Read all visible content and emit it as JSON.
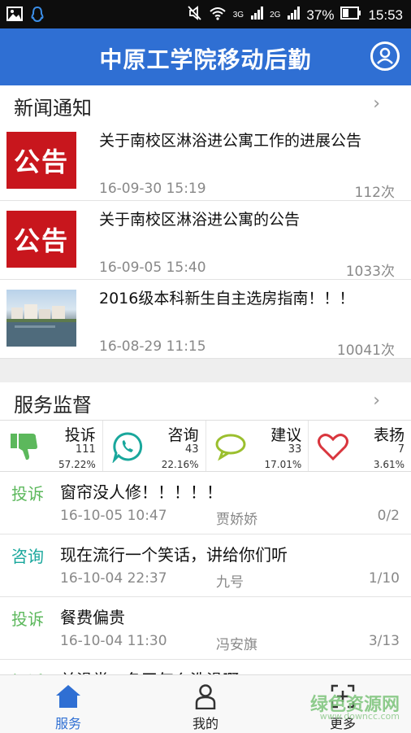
{
  "status_bar": {
    "network_3g": "3G",
    "network_2g": "2G",
    "battery": "37%",
    "time": "15:53"
  },
  "header": {
    "title": "中原工学院移动后勤"
  },
  "news": {
    "section_title": "新闻通知",
    "items": [
      {
        "thumb_text": "公告",
        "title": "关于南校区淋浴进公寓工作的进展公告",
        "date": "16-09-30 15:19",
        "count": "112次"
      },
      {
        "thumb_text": "公告",
        "title": "关于南校区淋浴进公寓的公告",
        "date": "16-09-05 15:40",
        "count": "1033次"
      },
      {
        "thumb_text": "",
        "title": "2016级本科新生自主选房指南！！！",
        "date": "16-08-29 11:15",
        "count": "10041次"
      }
    ]
  },
  "service": {
    "section_title": "服务监督",
    "stats": [
      {
        "name": "投诉",
        "count": "111",
        "percent": "57.22%",
        "icon": "thumbs-down-icon",
        "color": "#5cb85c"
      },
      {
        "name": "咨询",
        "count": "43",
        "percent": "22.16%",
        "icon": "chat-phone-icon",
        "color": "#19a79c"
      },
      {
        "name": "建议",
        "count": "33",
        "percent": "17.01%",
        "icon": "speech-bubble-icon",
        "color": "#9bbf2e"
      },
      {
        "name": "表扬",
        "count": "7",
        "percent": "3.61%",
        "icon": "heart-icon",
        "color": "#d9363e"
      }
    ],
    "items": [
      {
        "tag": "投诉",
        "tag_color": "#5cb85c",
        "title": "窗帘没人修！！！！！",
        "date": "16-10-05 10:47",
        "user": "贾娇娇",
        "count": "0/2"
      },
      {
        "tag": "咨询",
        "tag_color": "#19a79c",
        "title": "现在流行一个笑话，讲给你们听",
        "date": "16-10-04 22:37",
        "user": "九号",
        "count": "1/10"
      },
      {
        "tag": "投诉",
        "tag_color": "#5cb85c",
        "title": "餐费偏贵",
        "date": "16-10-04 11:30",
        "user": "冯安旗",
        "count": "3/13"
      },
      {
        "tag": "投诉",
        "tag_color": "#5cb85c",
        "title": "关澡堂，冬天怎么洗澡啊",
        "date": "",
        "user": "",
        "count": ""
      }
    ]
  },
  "tabbar": {
    "tabs": [
      {
        "label": "服务",
        "active": true
      },
      {
        "label": "我的",
        "active": false
      },
      {
        "label": "更多",
        "active": false
      }
    ]
  },
  "watermark": {
    "text": "绿色资源网",
    "url": "www.downcc.com"
  },
  "colors": {
    "primary": "#2f6fd3",
    "announcement_red": "#c8161d"
  }
}
